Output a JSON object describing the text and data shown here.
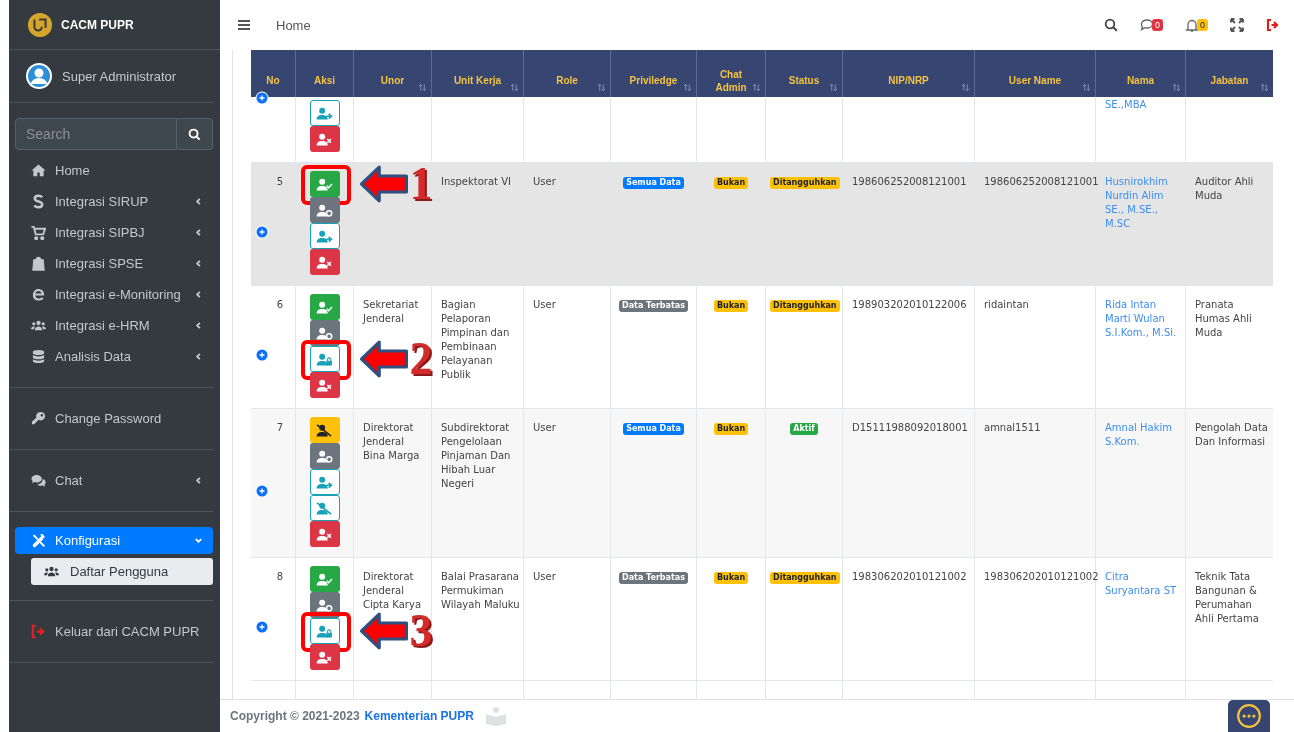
{
  "brand": {
    "name": "CACM PUPR"
  },
  "user": {
    "name": "Super Administrator"
  },
  "sidebar": {
    "search": {
      "placeholder": "Search"
    },
    "groups": [
      {
        "items": [
          {
            "label": "Home",
            "kind": "home",
            "has_submenu": false,
            "selected": false
          },
          {
            "label": "Integrasi SIRUP",
            "kind": "dollar",
            "has_submenu": true,
            "expanded": false,
            "selected": false
          },
          {
            "label": "Integrasi SIPBJ",
            "kind": "cart",
            "has_submenu": true,
            "expanded": false,
            "selected": false
          },
          {
            "label": "Integrasi SPSE",
            "kind": "bag",
            "has_submenu": true,
            "expanded": false,
            "selected": false
          },
          {
            "label": "Integrasi e-Monitoring",
            "kind": "browser",
            "has_submenu": true,
            "expanded": false,
            "selected": false
          },
          {
            "label": "Integrasi e-HRM",
            "kind": "users",
            "has_submenu": true,
            "expanded": false,
            "selected": false
          },
          {
            "label": "Analisis Data",
            "kind": "database",
            "has_submenu": true,
            "expanded": false,
            "selected": false
          }
        ]
      },
      {
        "items": [
          {
            "label": "Change Password",
            "kind": "key",
            "has_submenu": false,
            "selected": false
          }
        ]
      },
      {
        "items": [
          {
            "label": "Chat",
            "kind": "chat",
            "has_submenu": true,
            "expanded": false,
            "selected": false
          }
        ]
      },
      {
        "items": [
          {
            "label": "Konfigurasi",
            "kind": "tools",
            "has_submenu": true,
            "expanded": true,
            "selected": true,
            "children": [
              {
                "label": "Daftar Pengguna",
                "selected": true
              }
            ]
          }
        ]
      },
      {
        "items": [
          {
            "label": "Keluar dari CACM PUPR",
            "kind": "logout",
            "has_submenu": false,
            "selected": false
          }
        ]
      }
    ]
  },
  "topbar": {
    "breadcrumb": "Home",
    "chat_count": "0",
    "notification_count": "0"
  },
  "table": {
    "columns": [
      {
        "label": "No",
        "sortable": false
      },
      {
        "label": "Aksi",
        "sortable": false
      },
      {
        "label": "Unor",
        "sortable": true
      },
      {
        "label": "Unit Kerja",
        "sortable": true
      },
      {
        "label": "Role",
        "sortable": true
      },
      {
        "label": "Priviledge",
        "sortable": true
      },
      {
        "label": "Chat Admin",
        "sortable": true
      },
      {
        "label": "Status",
        "sortable": true
      },
      {
        "label": "NIP/NRP",
        "sortable": true
      },
      {
        "label": "User Name",
        "sortable": true
      },
      {
        "label": "Nama",
        "sortable": true
      },
      {
        "label": "Jabatan",
        "sortable": true
      }
    ],
    "rows": [
      {
        "highlighted": false,
        "actions": [
          {
            "kind": "transfer"
          },
          {
            "kind": "delete"
          }
        ],
        "nama": "SE.,MBA"
      },
      {
        "no": "5",
        "highlighted": true,
        "actions": [
          {
            "kind": "approve",
            "callout": "1"
          },
          {
            "kind": "settings"
          },
          {
            "kind": "transfer"
          },
          {
            "kind": "delete"
          }
        ],
        "unit_kerja": "Inspektorat VI",
        "role": "User",
        "privilege": {
          "text": "Semua Data",
          "color": "#007bff"
        },
        "chat_admin": {
          "text": "Bukan",
          "color": "#ffc107"
        },
        "status": {
          "text": "Ditangguhkan",
          "color": "#ffc107"
        },
        "nip": "198606252008121001",
        "username": "198606252008121001",
        "nama": "Husnirokhim Nurdin Alim SE., M.SE., M.SC",
        "jabatan": "Auditor Ahli Muda"
      },
      {
        "no": "6",
        "highlighted": false,
        "actions": [
          {
            "kind": "approve"
          },
          {
            "kind": "settings"
          },
          {
            "kind": "lock",
            "callout": "2"
          },
          {
            "kind": "delete"
          }
        ],
        "unor": "Sekretariat Jenderal",
        "unit_kerja": "Bagian Pelaporan Pimpinan dan Pembinaan Pelayanan Publik",
        "role": "User",
        "privilege": {
          "text": "Data Terbatas",
          "color": "#6c757d"
        },
        "chat_admin": {
          "text": "Bukan",
          "color": "#ffc107"
        },
        "status": {
          "text": "Ditangguhkan",
          "color": "#ffc107"
        },
        "nip": "198903202010122006",
        "username": "ridaintan",
        "nama": "Rida Intan Marti Wulan S.I.Kom., M.Si.",
        "jabatan": "Pranata Humas Ahli Muda"
      },
      {
        "no": "7",
        "highlighted": false,
        "actions": [
          {
            "kind": "ban"
          },
          {
            "kind": "settings"
          },
          {
            "kind": "transfer"
          },
          {
            "kind": "chat-off"
          },
          {
            "kind": "delete"
          }
        ],
        "unor": "Direktorat Jenderal Bina Marga",
        "unit_kerja": "Subdirektorat Pengelolaan Pinjaman Dan Hibah Luar Negeri",
        "role": "User",
        "privilege": {
          "text": "Semua Data",
          "color": "#007bff"
        },
        "chat_admin": {
          "text": "Bukan",
          "color": "#ffc107"
        },
        "status": {
          "text": "Aktif",
          "color": "#28a745"
        },
        "nip": "D15111988092018001",
        "username": "amnal1511",
        "nama": "Amnal Hakim S.Kom.",
        "jabatan": "Pengolah Data Dan Informasi"
      },
      {
        "no": "8",
        "highlighted": false,
        "actions": [
          {
            "kind": "approve"
          },
          {
            "kind": "settings"
          },
          {
            "kind": "lock",
            "callout": "3"
          },
          {
            "kind": "delete"
          }
        ],
        "unor": "Direktorat Jenderal Cipta Karya",
        "unit_kerja": "Balai Prasarana Permukiman Wilayah Maluku",
        "role": "User",
        "privilege": {
          "text": "Data Terbatas",
          "color": "#6c757d"
        },
        "chat_admin": {
          "text": "Bukan",
          "color": "#ffc107"
        },
        "status": {
          "text": "Ditangguhkan",
          "color": "#ffc107"
        },
        "nip": "198306202010121002",
        "username": "198306202010121002",
        "nama": "Citra Suryantara ST",
        "jabatan": "Teknik Tata Bangunan & Perumahan Ahli Pertama"
      }
    ]
  },
  "footer": {
    "copyright": "Copyright © 2021-2023",
    "link": "Kementerian PUPR"
  }
}
